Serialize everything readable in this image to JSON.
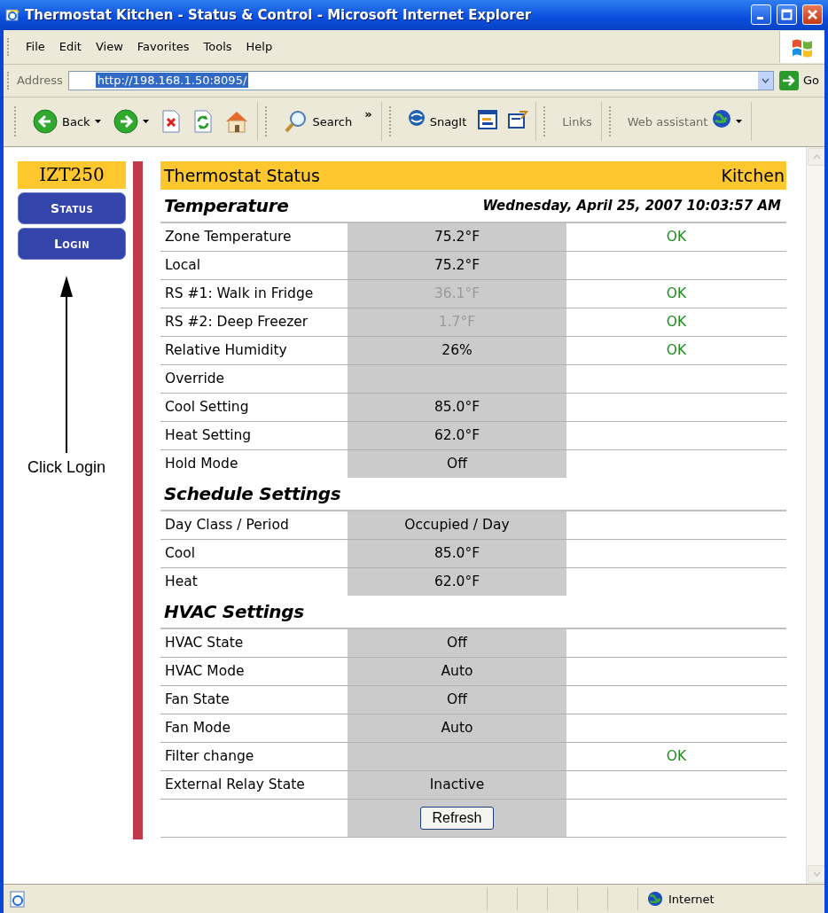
{
  "window": {
    "title": "Thermostat Kitchen - Status & Control - Microsoft Internet Explorer"
  },
  "menu": [
    "File",
    "Edit",
    "View",
    "Favorites",
    "Tools",
    "Help"
  ],
  "address": {
    "label": "Address",
    "url": "http://198.168.1.50:8095/",
    "url_selected": true,
    "go": "Go"
  },
  "toolbar": {
    "groups": [
      [
        {
          "kind": "back",
          "label": "Back"
        },
        {
          "kind": "forward"
        },
        {
          "kind": "stop"
        },
        {
          "kind": "refresh"
        },
        {
          "kind": "home"
        }
      ],
      [
        {
          "kind": "search",
          "label": "Search"
        },
        {
          "kind": "more",
          "label": "»"
        }
      ],
      [
        {
          "kind": "snagit",
          "label": "SnagIt"
        },
        {
          "kind": "capture"
        },
        {
          "kind": "edit"
        }
      ],
      [
        {
          "kind": "links",
          "label": "Links"
        }
      ],
      [
        {
          "kind": "assistant",
          "label": "Web assistant"
        }
      ]
    ]
  },
  "sidebar": {
    "title": "IZT250",
    "nav": [
      {
        "label": "Status"
      },
      {
        "label": "Login"
      }
    ]
  },
  "annotation": {
    "text": "Click Login"
  },
  "status_header": {
    "title": "Thermostat Status",
    "zone": "Kitchen"
  },
  "sections": [
    {
      "heading": "Temperature",
      "timestamp": "Wednesday, April 25, 2007 10:03:57 AM",
      "rows": [
        {
          "label": "Zone Temperature",
          "value": "75.2°F",
          "dimmed": false,
          "status": "OK"
        },
        {
          "label": "Local",
          "value": "75.2°F",
          "dimmed": false
        },
        {
          "label": "RS #1: Walk in Fridge",
          "value": "36.1°F",
          "dimmed": true,
          "status": "OK"
        },
        {
          "label": "RS #2: Deep Freezer",
          "value": "1.7°F",
          "dimmed": true,
          "status": "OK"
        },
        {
          "label": "Relative Humidity",
          "value": "26%",
          "dimmed": false,
          "status": "OK"
        },
        {
          "label": "Override"
        },
        {
          "label": "Cool Setting",
          "value": "85.0°F",
          "dimmed": false
        },
        {
          "label": "Heat Setting",
          "value": "62.0°F",
          "dimmed": false
        },
        {
          "label": "Hold Mode",
          "value": "Off",
          "dimmed": false
        }
      ]
    },
    {
      "heading": "Schedule Settings",
      "rows": [
        {
          "label": "Day Class / Period",
          "value": "Occupied / Day",
          "dimmed": false
        },
        {
          "label": "Cool",
          "value": "85.0°F",
          "dimmed": false
        },
        {
          "label": "Heat",
          "value": "62.0°F",
          "dimmed": false
        }
      ]
    },
    {
      "heading": "HVAC Settings",
      "rows": [
        {
          "label": "HVAC State",
          "value": "Off",
          "dimmed": false
        },
        {
          "label": "HVAC Mode",
          "value": "Auto",
          "dimmed": false
        },
        {
          "label": "Fan State",
          "value": "Off",
          "dimmed": false
        },
        {
          "label": "Fan Mode",
          "value": "Auto",
          "dimmed": false
        },
        {
          "label": "Filter change",
          "status": "OK"
        },
        {
          "label": "External Relay State",
          "value": "Inactive",
          "dimmed": false
        }
      ]
    }
  ],
  "refresh_button": "Refresh",
  "status_bar": {
    "zone": "Internet"
  }
}
